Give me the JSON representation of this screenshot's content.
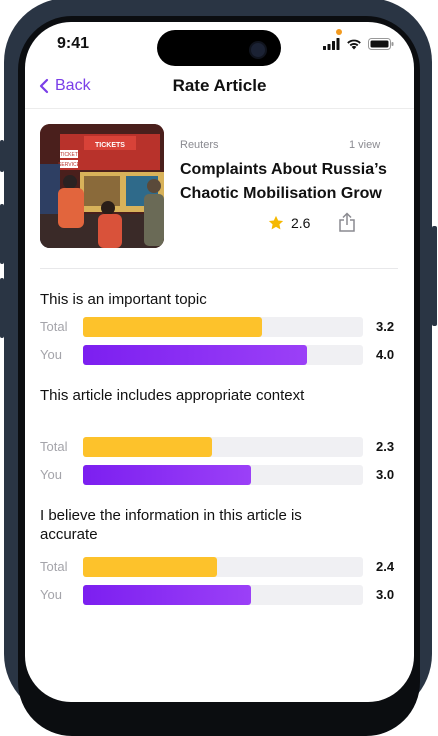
{
  "status_bar": {
    "time": "9:41"
  },
  "nav": {
    "back_label": "Back",
    "title": "Rate Article"
  },
  "article": {
    "source": "Reuters",
    "views": "1 view",
    "title": "Complaints About Russia’s Chaotic Mobilisation Grow",
    "rating": "2.6",
    "thumbnail_signs": [
      "TICKETS",
      "TICKET",
      "SERVICE"
    ]
  },
  "questions": [
    {
      "title": "This is an important topic",
      "total": {
        "label": "Total",
        "value": "3.2",
        "fraction": 0.64
      },
      "you": {
        "label": "You",
        "value": "4.0",
        "fraction": 0.8
      }
    },
    {
      "title": "This article includes appropriate context",
      "total": {
        "label": "Total",
        "value": "2.3",
        "fraction": 0.46
      },
      "you": {
        "label": "You",
        "value": "3.0",
        "fraction": 0.6
      }
    },
    {
      "title": "I believe the information in this article is accurate",
      "total": {
        "label": "Total",
        "value": "2.4",
        "fraction": 0.48
      },
      "you": {
        "label": "You",
        "value": "3.0",
        "fraction": 0.6
      }
    }
  ],
  "colors": {
    "accent": "#7a3ee8",
    "total_bar": "#fdc22b",
    "you_bar": "#7c1ff0",
    "star": "#f5b800"
  },
  "icons": [
    "back-chevron-icon",
    "star-icon",
    "share-icon",
    "signal-icon",
    "wifi-icon",
    "battery-icon"
  ]
}
